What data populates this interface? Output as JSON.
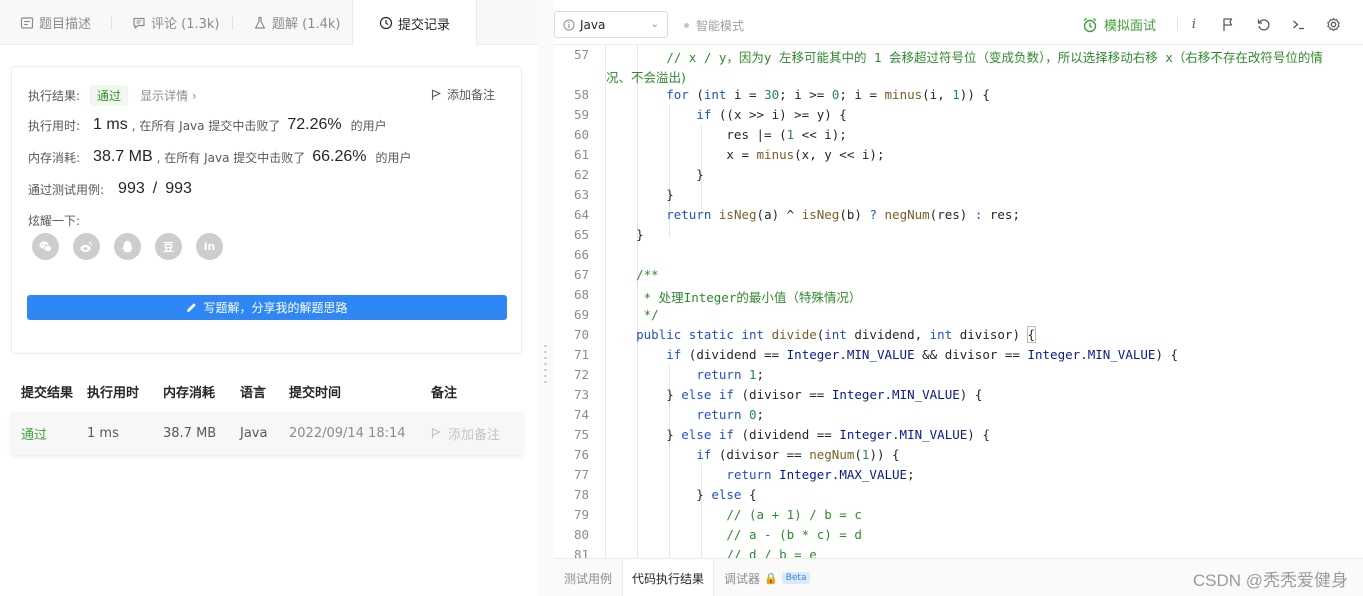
{
  "left_tabs": [
    {
      "label": "题目描述",
      "icon": "document-icon"
    },
    {
      "label": "评论 (1.3k)",
      "icon": "comment-icon"
    },
    {
      "label": "题解 (1.4k)",
      "icon": "flask-icon"
    },
    {
      "label": "提交记录",
      "icon": "clock-icon",
      "active": true
    }
  ],
  "result": {
    "status_label": "执行结果:",
    "status_value": "通过",
    "detail_link": "显示详情 ›",
    "add_note": "添加备注",
    "runtime_label": "执行用时:",
    "runtime_value": "1 ms",
    "runtime_mid": ", 在所有 Java 提交中击败了",
    "runtime_pct": "72.26%",
    "runtime_suffix": "的用户",
    "memory_label": "内存消耗:",
    "memory_value": "38.7 MB",
    "memory_mid": ", 在所有 Java 提交中击败了",
    "memory_pct": "66.26%",
    "memory_suffix": "的用户",
    "tests_label": "通过测试用例:",
    "tests_passed": "993",
    "tests_sep": "/",
    "tests_total": "993",
    "share_label": "炫耀一下:",
    "share_icons": [
      "wechat-icon",
      "weibo-icon",
      "qq-icon",
      "douban-icon",
      "linkedin-icon"
    ],
    "douban_glyph": "豆",
    "linkedin_glyph": "in",
    "write_button": "写题解，分享我的解题思路"
  },
  "submissions": {
    "headers": [
      "提交结果",
      "执行用时",
      "内存消耗",
      "语言",
      "提交时间",
      "备注"
    ],
    "rows": [
      {
        "result": "通过",
        "runtime": "1 ms",
        "memory": "38.7 MB",
        "language": "Java",
        "time": "2022/09/14 18:14",
        "note": "添加备注"
      }
    ]
  },
  "toolbar": {
    "language": "Java",
    "smart_mode": "智能模式",
    "mock_interview": "模拟面试",
    "info_glyph": "i",
    "accent": "#3ea23a"
  },
  "editor": {
    "line_numbers": [
      "57",
      "58",
      "59",
      "60",
      "61",
      "62",
      "63",
      "64",
      "65",
      "66",
      "67",
      "68",
      "69",
      "70",
      "71",
      "72",
      "73",
      "74",
      "75",
      "76",
      "77",
      "78",
      "79",
      "80",
      "81"
    ],
    "line57_a": "        // x / y，因为y 左移可能其中的 1 会移超过符号位（变成负数），所以选择移动右移 x（右移不存在改符号位的情",
    "line57_b": "况、不会溢出)"
  },
  "bottom_tabs": [
    "测试用例",
    "代码执行结果",
    "调试器"
  ],
  "beta": "Beta",
  "watermark": "CSDN @秃秃爱健身"
}
